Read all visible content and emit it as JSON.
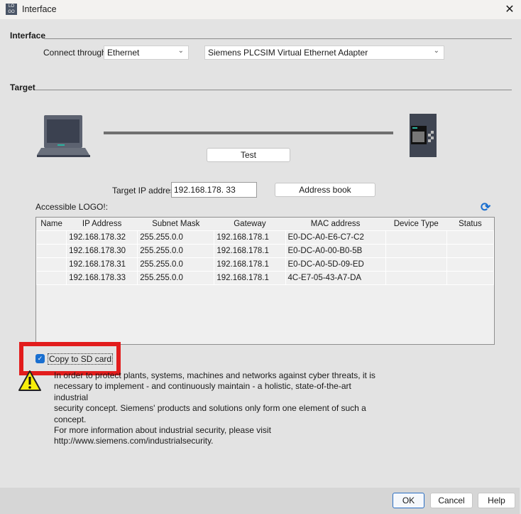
{
  "window": {
    "title": "Interface",
    "app_icon": "logo-soft-comfort-icon",
    "close_icon": "close-icon"
  },
  "interface_section": {
    "label": "Interface",
    "connect_label": "Connect through:",
    "connect_value": "Ethernet",
    "adapter_value": "Siemens PLCSIM Virtual Ethernet Adapter"
  },
  "target_section": {
    "label": "Target",
    "test_button": "Test",
    "ip_label": "Target IP address:",
    "ip_value": "192.168.178. 33",
    "address_book_button": "Address book",
    "accessible_label": "Accessible LOGO!:",
    "refresh_icon": "refresh-icon"
  },
  "table": {
    "columns": [
      "Name",
      "IP Address",
      "Subnet Mask",
      "Gateway",
      "MAC address",
      "Device Type",
      "Status"
    ],
    "rows": [
      [
        "",
        "192.168.178.32",
        "255.255.0.0",
        "192.168.178.1",
        "E0-DC-A0-E6-C7-C2",
        "",
        ""
      ],
      [
        "",
        "192.168.178.30",
        "255.255.0.0",
        "192.168.178.1",
        "E0-DC-A0-00-B0-5B",
        "",
        ""
      ],
      [
        "",
        "192.168.178.31",
        "255.255.0.0",
        "192.168.178.1",
        "E0-DC-A0-5D-09-ED",
        "",
        ""
      ],
      [
        "",
        "192.168.178.33",
        "255.255.0.0",
        "192.168.178.1",
        "4C-E7-05-43-A7-DA",
        "",
        ""
      ]
    ]
  },
  "copy_sd": {
    "label": "Copy to SD card",
    "checked": true
  },
  "warning": {
    "icon": "warning-icon",
    "lines": [
      "In order to protect plants, systems, machines and networks against cyber threats, it is",
      "necessary to implement - and continuously maintain - a holistic, state-of-the-art industrial",
      "security concept. Siemens' products and solutions only form one element of such a concept.",
      "For more information about industrial security, please visit",
      "http://www.siemens.com/industrialsecurity."
    ]
  },
  "footer": {
    "ok": "OK",
    "cancel": "Cancel",
    "help": "Help"
  },
  "colors": {
    "highlight": "#e21c1c",
    "checkbox": "#1a6fd0"
  }
}
